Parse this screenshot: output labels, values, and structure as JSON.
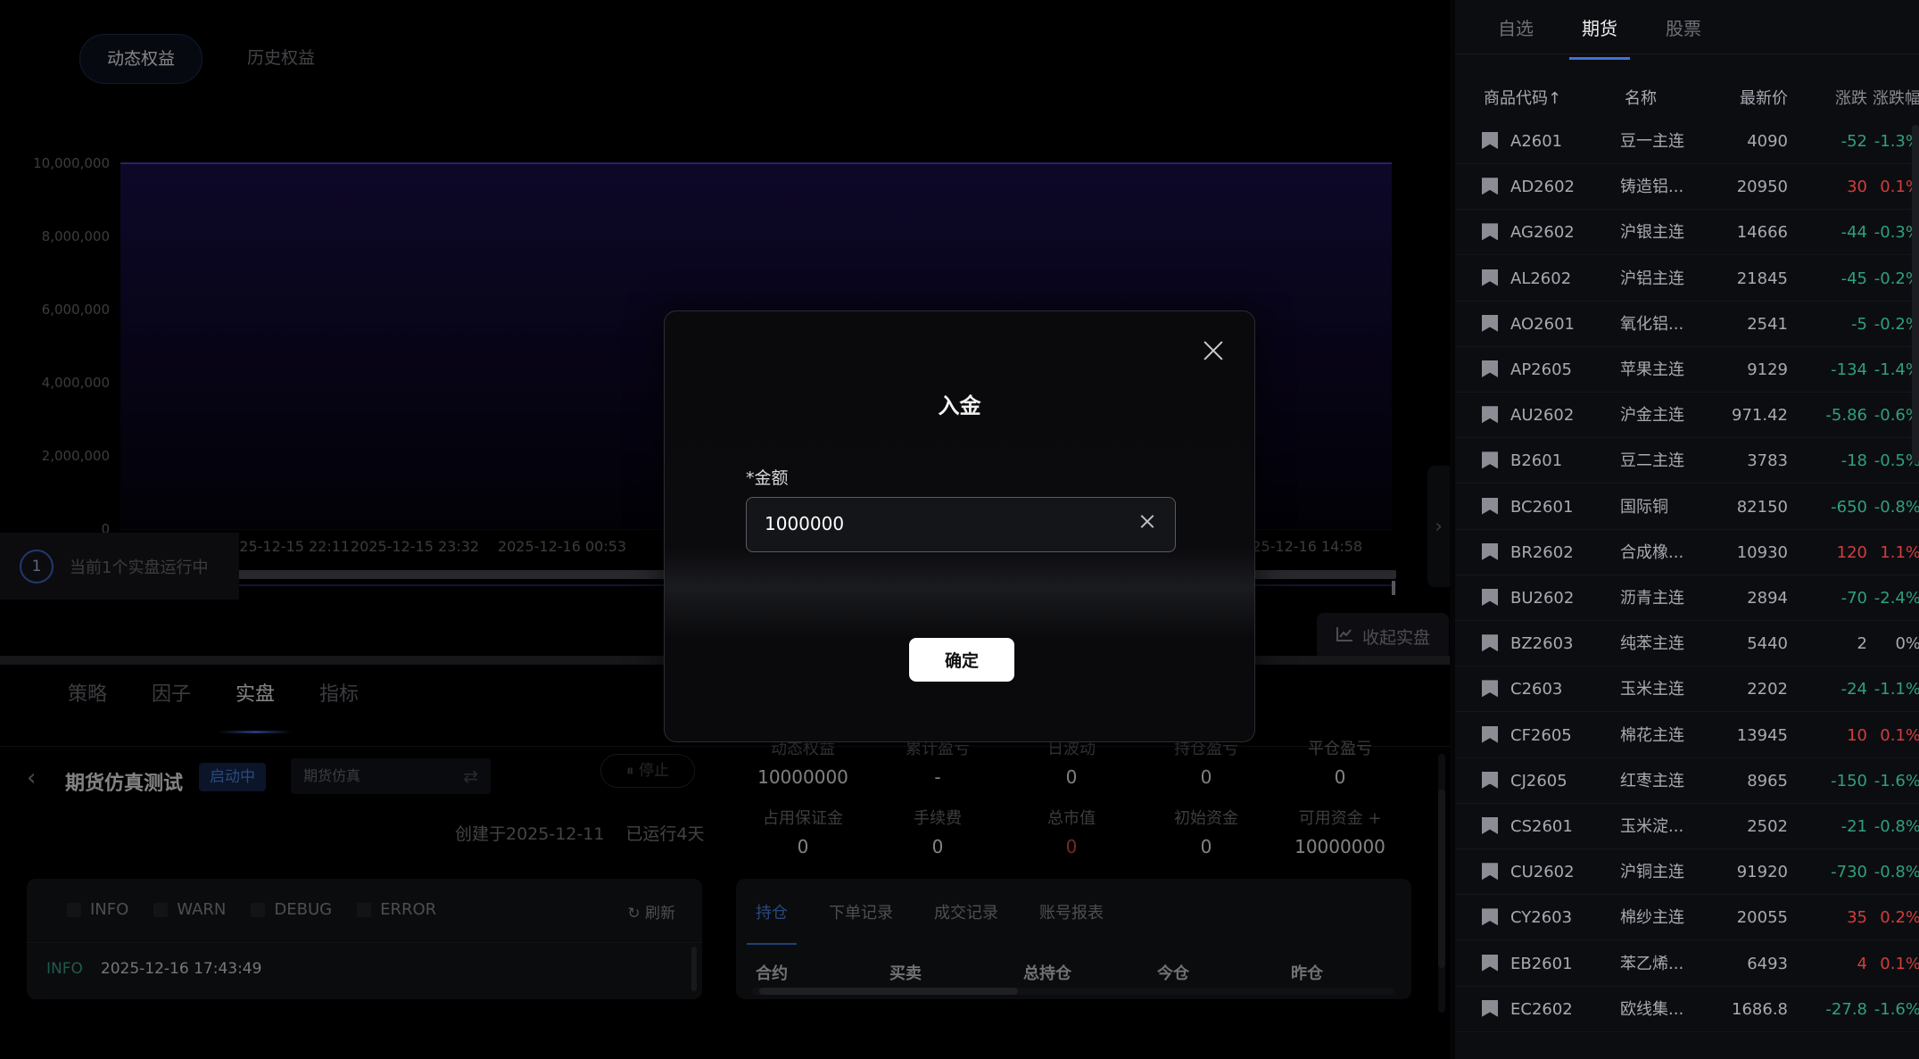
{
  "equity_tabs": [
    "动态权益",
    "历史权益"
  ],
  "chart_data": {
    "type": "area",
    "y_ticks": [
      "10,000,000",
      "8,000,000",
      "6,000,000",
      "4,000,000",
      "2,000,000",
      "0"
    ],
    "x_ticks": [
      "2025-12-15 22:11",
      "2025-12-15 23:32",
      "2025-12-16 00:53",
      "2025-12-16 14:58"
    ],
    "ylim": [
      0,
      10000000
    ],
    "series": [
      {
        "values": [
          10000000,
          10000000
        ]
      }
    ],
    "colors": {
      "line": "#4a3fb8",
      "fill_top": "#1a0f4a",
      "fill_bottom": "#05030d"
    }
  },
  "running_banner": {
    "icon": "clock-icon",
    "text": "当前1个实盘运行中"
  },
  "collapse_button": {
    "icon": "chart-line-icon",
    "label": "收起实盘"
  },
  "main_tabs": [
    "策略",
    "因子",
    "实盘",
    "指标"
  ],
  "strategy": {
    "name": "期货仿真测试",
    "status": "启动中",
    "mode": "期货仿真",
    "stop_label": "⏸ 停止",
    "created": "创建于2025-12-11",
    "running_days": "已运行4天"
  },
  "stats": [
    {
      "label": "动态权益",
      "value": "10000000"
    },
    {
      "label": "累计盈亏",
      "value": "-"
    },
    {
      "label": "日波动",
      "value": "0"
    },
    {
      "label": "持仓盈亏",
      "value": "0"
    },
    {
      "label": "平仓盈亏",
      "value": "0"
    },
    {
      "label": "占用保证金",
      "value": "0"
    },
    {
      "label": "手续费",
      "value": "0"
    },
    {
      "label": "总市值",
      "value": "0"
    },
    {
      "label": "初始资金",
      "value": "0"
    },
    {
      "label": "可用资金 +",
      "value": "10000000"
    }
  ],
  "log": {
    "filters": [
      "INFO",
      "WARN",
      "DEBUG",
      "ERROR"
    ],
    "refresh_label": "刷新",
    "entries": [
      {
        "level": "INFO",
        "time": "2025-12-16 17:43:49"
      }
    ]
  },
  "positions": {
    "tabs": [
      "持仓",
      "下单记录",
      "成交记录",
      "账号报表"
    ],
    "columns": [
      "合约",
      "买卖",
      "总持仓",
      "今仓",
      "昨仓"
    ]
  },
  "market": {
    "tabs": [
      "自选",
      "期货",
      "股票"
    ],
    "headers": [
      "商品代码↑",
      "名称",
      "最新价",
      "涨跌",
      "涨跌幅"
    ],
    "rows": [
      {
        "code": "A2601",
        "name": "豆一主连",
        "price": "4090",
        "chg": "-52",
        "pct": "-1.3%",
        "dir": "down"
      },
      {
        "code": "AD2602",
        "name": "铸造铝...",
        "price": "20950",
        "chg": "30",
        "pct": "0.1%",
        "dir": "up"
      },
      {
        "code": "AG2602",
        "name": "沪银主连",
        "price": "14666",
        "chg": "-44",
        "pct": "-0.3%",
        "dir": "down"
      },
      {
        "code": "AL2602",
        "name": "沪铝主连",
        "price": "21845",
        "chg": "-45",
        "pct": "-0.2%",
        "dir": "down"
      },
      {
        "code": "AO2601",
        "name": "氧化铝...",
        "price": "2541",
        "chg": "-5",
        "pct": "-0.2%",
        "dir": "down"
      },
      {
        "code": "AP2605",
        "name": "苹果主连",
        "price": "9129",
        "chg": "-134",
        "pct": "-1.4%",
        "dir": "down"
      },
      {
        "code": "AU2602",
        "name": "沪金主连",
        "price": "971.42",
        "chg": "-5.86",
        "pct": "-0.6%",
        "dir": "down"
      },
      {
        "code": "B2601",
        "name": "豆二主连",
        "price": "3783",
        "chg": "-18",
        "pct": "-0.5%",
        "dir": "down"
      },
      {
        "code": "BC2601",
        "name": "国际铜",
        "price": "82150",
        "chg": "-650",
        "pct": "-0.8%",
        "dir": "down"
      },
      {
        "code": "BR2602",
        "name": "合成橡...",
        "price": "10930",
        "chg": "120",
        "pct": "1.1%",
        "dir": "up"
      },
      {
        "code": "BU2602",
        "name": "沥青主连",
        "price": "2894",
        "chg": "-70",
        "pct": "-2.4%",
        "dir": "down"
      },
      {
        "code": "BZ2603",
        "name": "纯苯主连",
        "price": "5440",
        "chg": "2",
        "pct": "0%",
        "dir": "flat"
      },
      {
        "code": "C2603",
        "name": "玉米主连",
        "price": "2202",
        "chg": "-24",
        "pct": "-1.1%",
        "dir": "down"
      },
      {
        "code": "CF2605",
        "name": "棉花主连",
        "price": "13945",
        "chg": "10",
        "pct": "0.1%",
        "dir": "up"
      },
      {
        "code": "CJ2605",
        "name": "红枣主连",
        "price": "8965",
        "chg": "-150",
        "pct": "-1.6%",
        "dir": "down"
      },
      {
        "code": "CS2601",
        "name": "玉米淀...",
        "price": "2502",
        "chg": "-21",
        "pct": "-0.8%",
        "dir": "down"
      },
      {
        "code": "CU2602",
        "name": "沪铜主连",
        "price": "91920",
        "chg": "-730",
        "pct": "-0.8%",
        "dir": "down"
      },
      {
        "code": "CY2603",
        "name": "棉纱主连",
        "price": "20055",
        "chg": "35",
        "pct": "0.2%",
        "dir": "up"
      },
      {
        "code": "EB2601",
        "name": "苯乙烯...",
        "price": "6493",
        "chg": "4",
        "pct": "0.1%",
        "dir": "up"
      },
      {
        "code": "EC2602",
        "name": "欧线集...",
        "price": "1686.8",
        "chg": "-27.8",
        "pct": "-1.6%",
        "dir": "down"
      }
    ]
  },
  "modal": {
    "title": "入金",
    "field_label": "*金额",
    "amount_value": "1000000",
    "confirm_label": "确定"
  }
}
